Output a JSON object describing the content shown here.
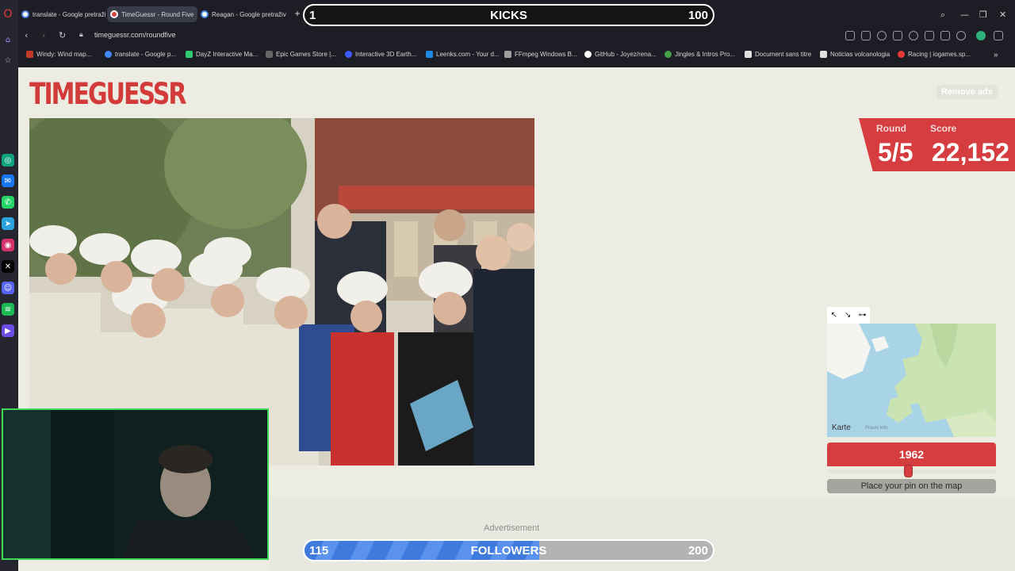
{
  "browser": {
    "tabs": [
      {
        "title": "translate - Google pretraži",
        "active": false
      },
      {
        "title": "TimeGuessr - Round Five",
        "active": true
      },
      {
        "title": "Reagan - Google pretraživ",
        "active": false
      }
    ],
    "new_tab_label": "+",
    "url": "timeguessr.com/roundfive",
    "bookmarks": [
      {
        "label": "Windy: Wind map...",
        "color": "#c0392b"
      },
      {
        "label": "translate - Google p...",
        "color": "#4285f4"
      },
      {
        "label": "DayZ Interactive Ma...",
        "color": "#2ecc71"
      },
      {
        "label": "Epic Games Store |...",
        "color": "#666666"
      },
      {
        "label": "Interactive 3D Earth...",
        "color": "#3d5afe"
      },
      {
        "label": "Leenks.com - Your d...",
        "color": "#1e88e5"
      },
      {
        "label": "FFmpeg Windows B...",
        "color": "#9e9e9e"
      },
      {
        "label": "GitHub - Joyez/rena...",
        "color": "#ffffff"
      },
      {
        "label": "Jingles & Intros Pro...",
        "color": "#43a047"
      },
      {
        "label": "Document sans titre",
        "color": "#e0e0e0"
      },
      {
        "label": "Noticias volcanologia",
        "color": "#e0e0e0"
      },
      {
        "label": "Racing | iogames.sp...",
        "color": "#e53935"
      }
    ]
  },
  "game": {
    "logo": "TIMEGUESSR",
    "remove_ads": "Remove ads",
    "round_label": "Round",
    "score_label": "Score",
    "round_value": "5/5",
    "score_value": "22,152",
    "map_attribution": " Karte",
    "map_legal": "Pravni info",
    "year_value": "1962",
    "year_slider_fraction": 0.48,
    "place_pin": "Place your pin on the map",
    "advertisement": "Advertisement"
  },
  "overlay": {
    "kicks": {
      "left": "1",
      "label": "KICKS",
      "right": "100"
    },
    "followers": {
      "left": "115",
      "label": "FOLLOWERS",
      "right": "200",
      "progress_fraction": 0.575
    }
  },
  "colors": {
    "accent": "#d63d40",
    "page_bg": "#edece2"
  }
}
